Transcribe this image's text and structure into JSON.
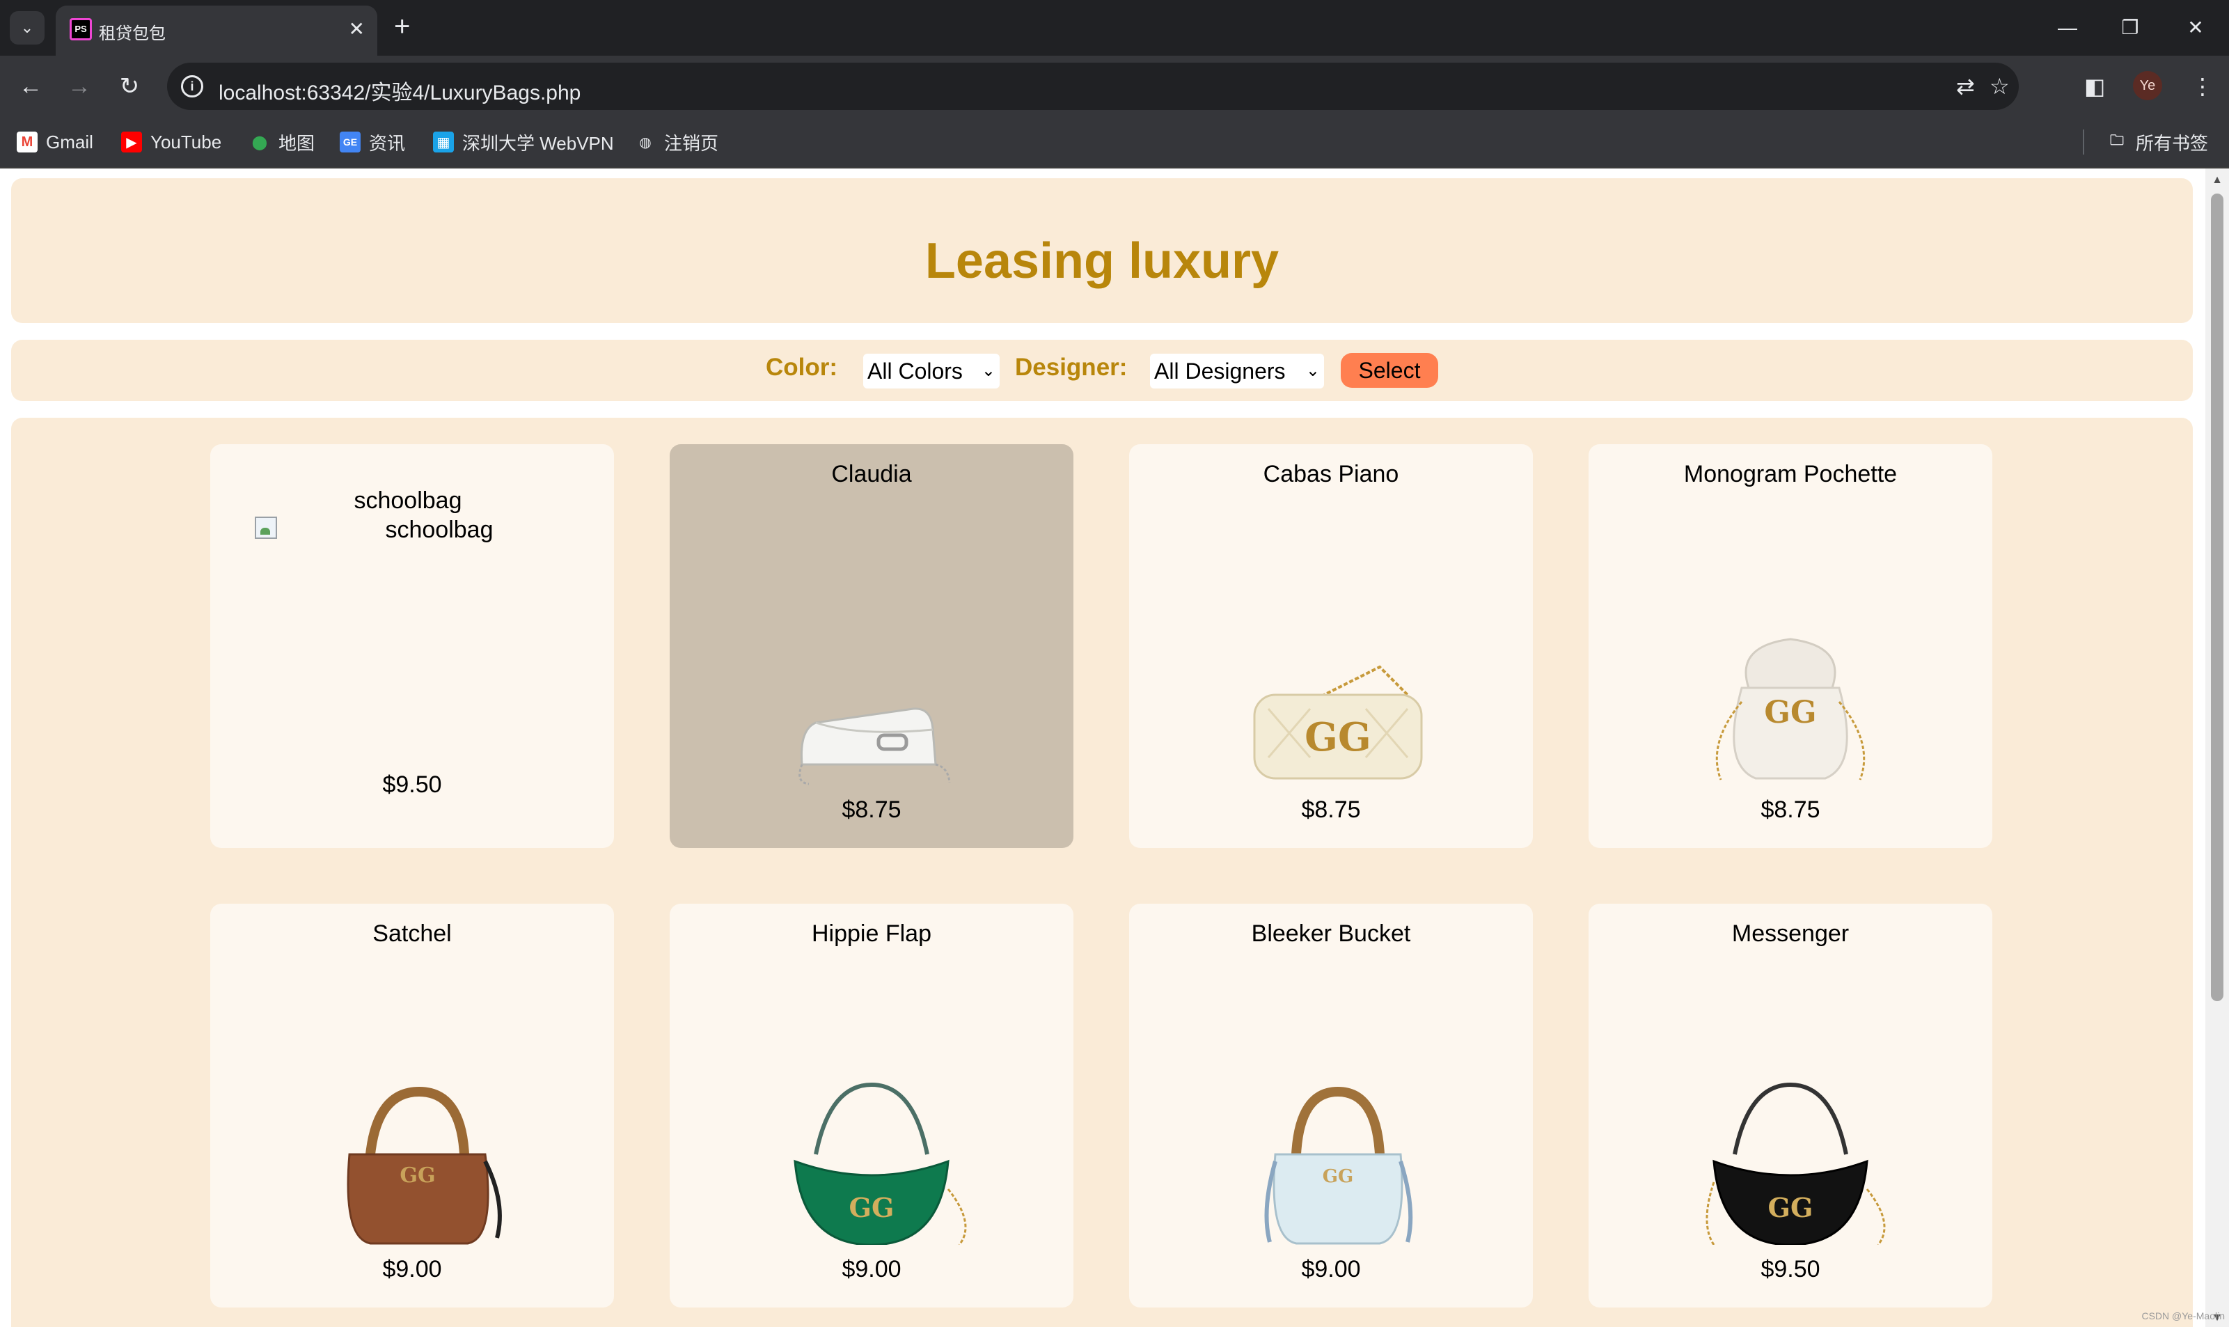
{
  "browser": {
    "tab_title": "租贷包包",
    "url": "localhost:63342/实验4/LuxuryBags.php",
    "profile_initials": "Ye",
    "bookmarks": [
      {
        "label": "Gmail",
        "icon": "gmail-icon",
        "color": "#ea4335"
      },
      {
        "label": "YouTube",
        "icon": "youtube-icon",
        "color": "#ff0000"
      },
      {
        "label": "地图",
        "icon": "maps-icon",
        "color": "#34a853"
      },
      {
        "label": "资讯",
        "icon": "news-icon",
        "color": "#4285f4"
      },
      {
        "label": "深圳大学 WebVPN",
        "icon": "webvpn-icon",
        "color": "#1aa3e8"
      },
      {
        "label": "注销页",
        "icon": "globe-icon",
        "color": "#e8eaed"
      }
    ],
    "all_bookmarks_label": "所有书签"
  },
  "page": {
    "title": "Leasing luxury",
    "filters": {
      "color_label": "Color:",
      "color_selected": "All Colors",
      "designer_label": "Designer:",
      "designer_selected": "All Designers",
      "select_button": "Select"
    },
    "products": [
      {
        "name": "",
        "alt": "schoolbag",
        "price": "$9.50",
        "image": "broken-image"
      },
      {
        "name": "Claudia",
        "price": "$8.75",
        "image": "white-shoulder-bag",
        "highlighted": true
      },
      {
        "name": "Cabas Piano",
        "price": "$8.75",
        "image": "cream-quilted-chain-bag"
      },
      {
        "name": "Monogram Pochette",
        "price": "$8.75",
        "image": "white-bucket-bag"
      },
      {
        "name": "Satchel",
        "price": "$9.00",
        "image": "brown-bamboo-handle-bag"
      },
      {
        "name": "Hippie Flap",
        "price": "$9.00",
        "image": "green-velvet-hobo-bag"
      },
      {
        "name": "Bleeker Bucket",
        "price": "$9.00",
        "image": "light-blue-bamboo-bag"
      },
      {
        "name": "Messenger",
        "price": "$9.50",
        "image": "black-hobo-bag"
      }
    ],
    "watermark": "CSDN @Ye-Maolin"
  },
  "colors": {
    "title_gold": "#b8860b",
    "panel_bg": "#faebd7",
    "card_bg": "#fdf7ef",
    "card_hover_bg": "#cbbfae",
    "button_bg": "#ff7f50"
  }
}
